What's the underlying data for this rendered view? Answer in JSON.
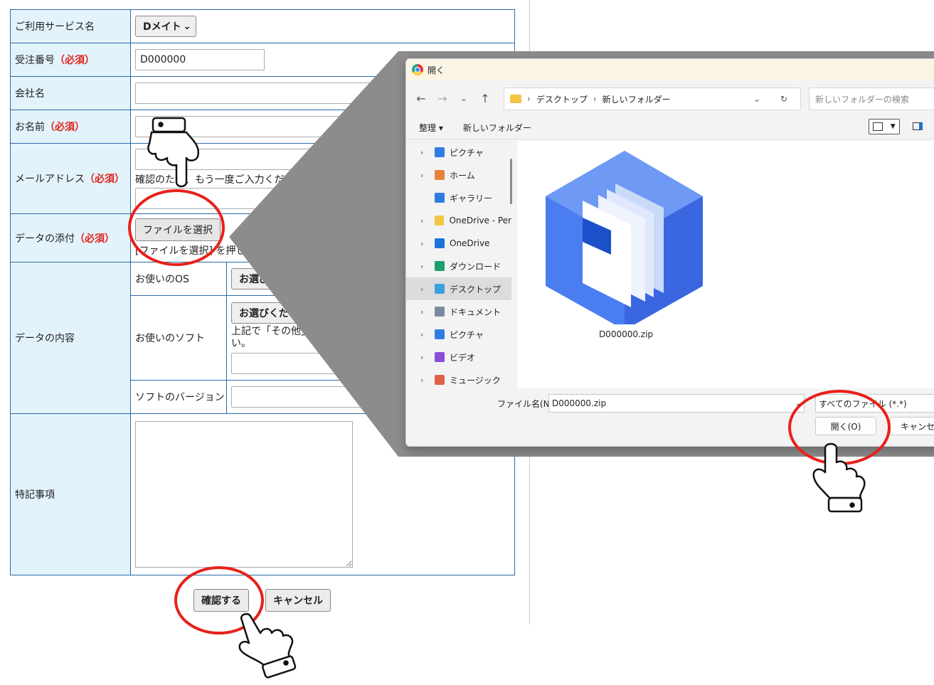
{
  "form": {
    "service": {
      "label": "ご利用サービス名",
      "selected": "Dメイト"
    },
    "order": {
      "label": "受注番号",
      "required": "（必須）",
      "value": "D000000"
    },
    "company": {
      "label": "会社名"
    },
    "name": {
      "label": "お名前",
      "required": "（必須）"
    },
    "email": {
      "label": "メールアドレス",
      "required": "（必須）",
      "confirm_note": "確認のため、もう一度ご入力ください。"
    },
    "attach": {
      "label": "データの添付",
      "required": "（必須）",
      "button": "ファイルを選択",
      "note": "[ファイルを選択] を押して、送信するデータをお選びください。"
    },
    "content": {
      "label": "データの内容",
      "os_label": "お使いのOS",
      "os_select": "お選びください",
      "soft_label": "お使いのソフト",
      "soft_select": "お選びください",
      "soft_note": "上記で「その他」を選んだ方は、ソフト名をご入力ください。",
      "version_label": "ソフトのバージョン"
    },
    "memo": {
      "label": "特記事項"
    },
    "confirm_button": "確認する",
    "cancel_button": "キャンセル"
  },
  "dialog": {
    "title": "開く",
    "path": [
      "デスクトップ",
      "新しいフォルダー"
    ],
    "search_placeholder": "新しいフォルダーの検索",
    "organize": "整理",
    "new_folder": "新しいフォルダー",
    "sidebar": [
      {
        "label": "ピクチャ",
        "icon": "pictures-icon",
        "color": "#2f7de1",
        "chevron": true
      },
      {
        "label": "ホーム",
        "icon": "home-icon",
        "color": "#e8823a",
        "chevron": true
      },
      {
        "label": "ギャラリー",
        "icon": "gallery-icon",
        "color": "#2f7de1",
        "chevron": false
      },
      {
        "label": "OneDrive - Per",
        "icon": "onedrive-folder-icon",
        "color": "#f5c542",
        "chevron": true
      },
      {
        "label": "OneDrive",
        "icon": "onedrive-icon",
        "color": "#1a73d9",
        "chevron": true
      },
      {
        "label": "ダウンロード",
        "icon": "download-icon",
        "color": "#1e9e6a",
        "chevron": true
      },
      {
        "label": "デスクトップ",
        "icon": "desktop-icon",
        "color": "#3ba0e0",
        "chevron": true,
        "active": true
      },
      {
        "label": "ドキュメント",
        "icon": "documents-icon",
        "color": "#7a8aa0",
        "chevron": true
      },
      {
        "label": "ピクチャ",
        "icon": "pictures-icon",
        "color": "#2f7de1",
        "chevron": true
      },
      {
        "label": "ビデオ",
        "icon": "video-icon",
        "color": "#8a4fd8",
        "chevron": true
      },
      {
        "label": "ミュージック",
        "icon": "music-icon",
        "color": "#e0604a",
        "chevron": true
      }
    ],
    "file": {
      "name": "D000000.zip"
    },
    "filename_label": "ファイル名(N):",
    "filename_value": "D000000.zip",
    "filter_value": "すべてのファイル (*.*)",
    "open_button": "開く(O)",
    "cancel_button": "キャンセル"
  },
  "colors": {
    "header_bg": "#e3f3fb",
    "border": "#2a6aa8",
    "required": "#e0231c",
    "highlight": "#e8211a"
  }
}
